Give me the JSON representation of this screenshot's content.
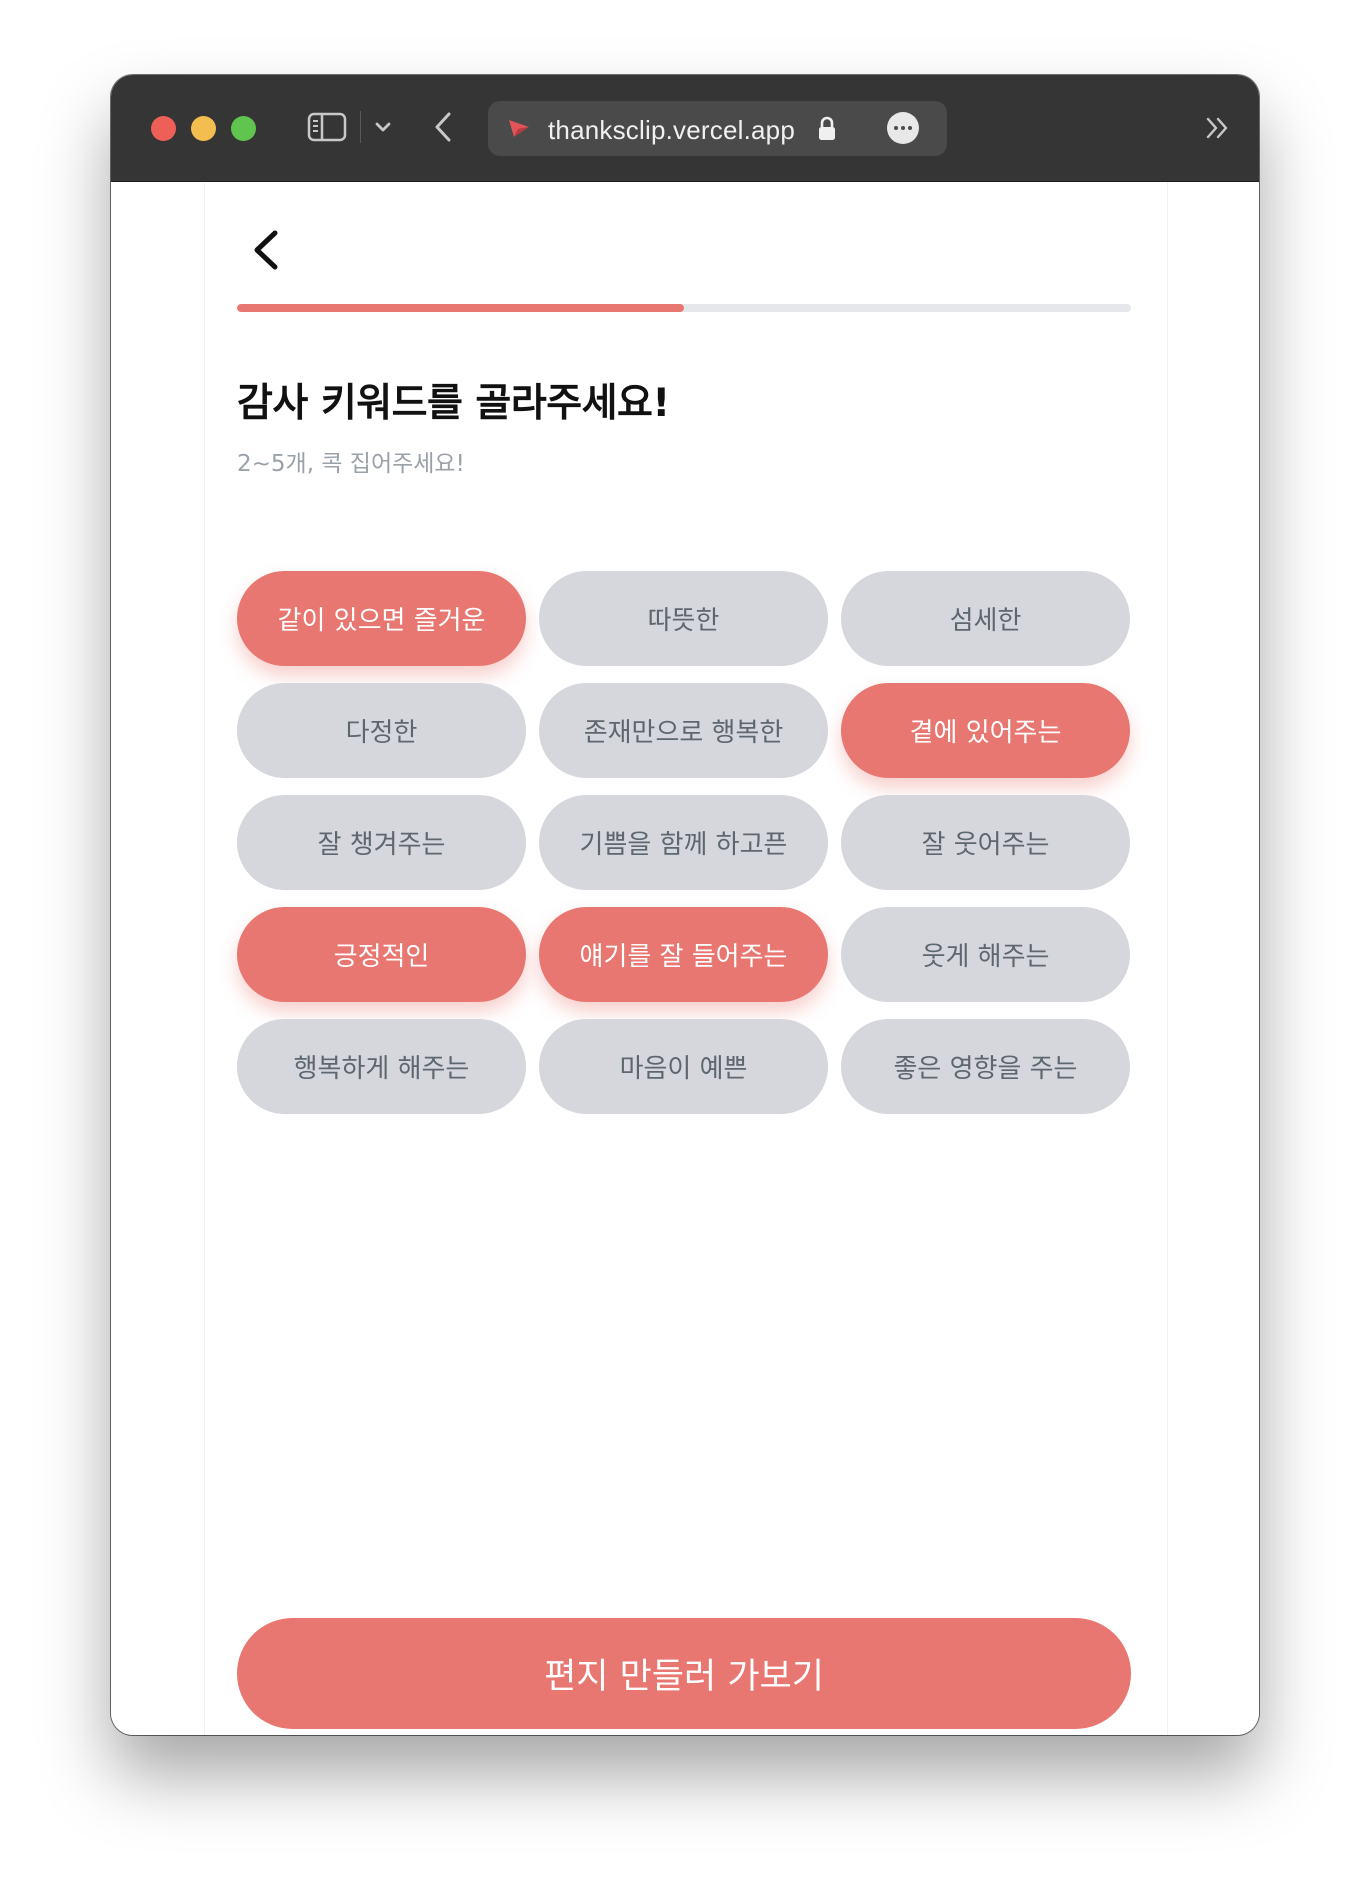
{
  "browser": {
    "url": "thanksclip.vercel.app"
  },
  "progress": {
    "fraction": 0.5
  },
  "header": {
    "title": "감사 키워드를 골라주세요!",
    "subtitle": "2~5개, 콕 집어주세요!"
  },
  "keywords": [
    {
      "label": "같이 있으면 즐거운",
      "selected": true
    },
    {
      "label": "따뜻한",
      "selected": false
    },
    {
      "label": "섬세한",
      "selected": false
    },
    {
      "label": "다정한",
      "selected": false
    },
    {
      "label": "존재만으로 행복한",
      "selected": false
    },
    {
      "label": "곁에 있어주는",
      "selected": true
    },
    {
      "label": "잘 챙겨주는",
      "selected": false
    },
    {
      "label": "기쁨을 함께 하고픈",
      "selected": false
    },
    {
      "label": "잘 웃어주는",
      "selected": false
    },
    {
      "label": "긍정적인",
      "selected": true
    },
    {
      "label": "얘기를 잘 들어주는",
      "selected": true
    },
    {
      "label": "웃게 해주는",
      "selected": false
    },
    {
      "label": "행복하게 해주는",
      "selected": false
    },
    {
      "label": "마음이 예쁜",
      "selected": false
    },
    {
      "label": "좋은 영향을 주는",
      "selected": false
    }
  ],
  "cta": {
    "label": "편지 만들러 가보기"
  },
  "colors": {
    "accent": "#e87771",
    "chip_default": "#d5d7dc",
    "chip_text": "#5e6670"
  },
  "icons": [
    "sidebar-icon",
    "chevron-down-icon",
    "back-arrow-icon",
    "favicon-icon",
    "lock-icon",
    "more-icon",
    "tabs-overflow-icon",
    "back-chevron-icon"
  ]
}
